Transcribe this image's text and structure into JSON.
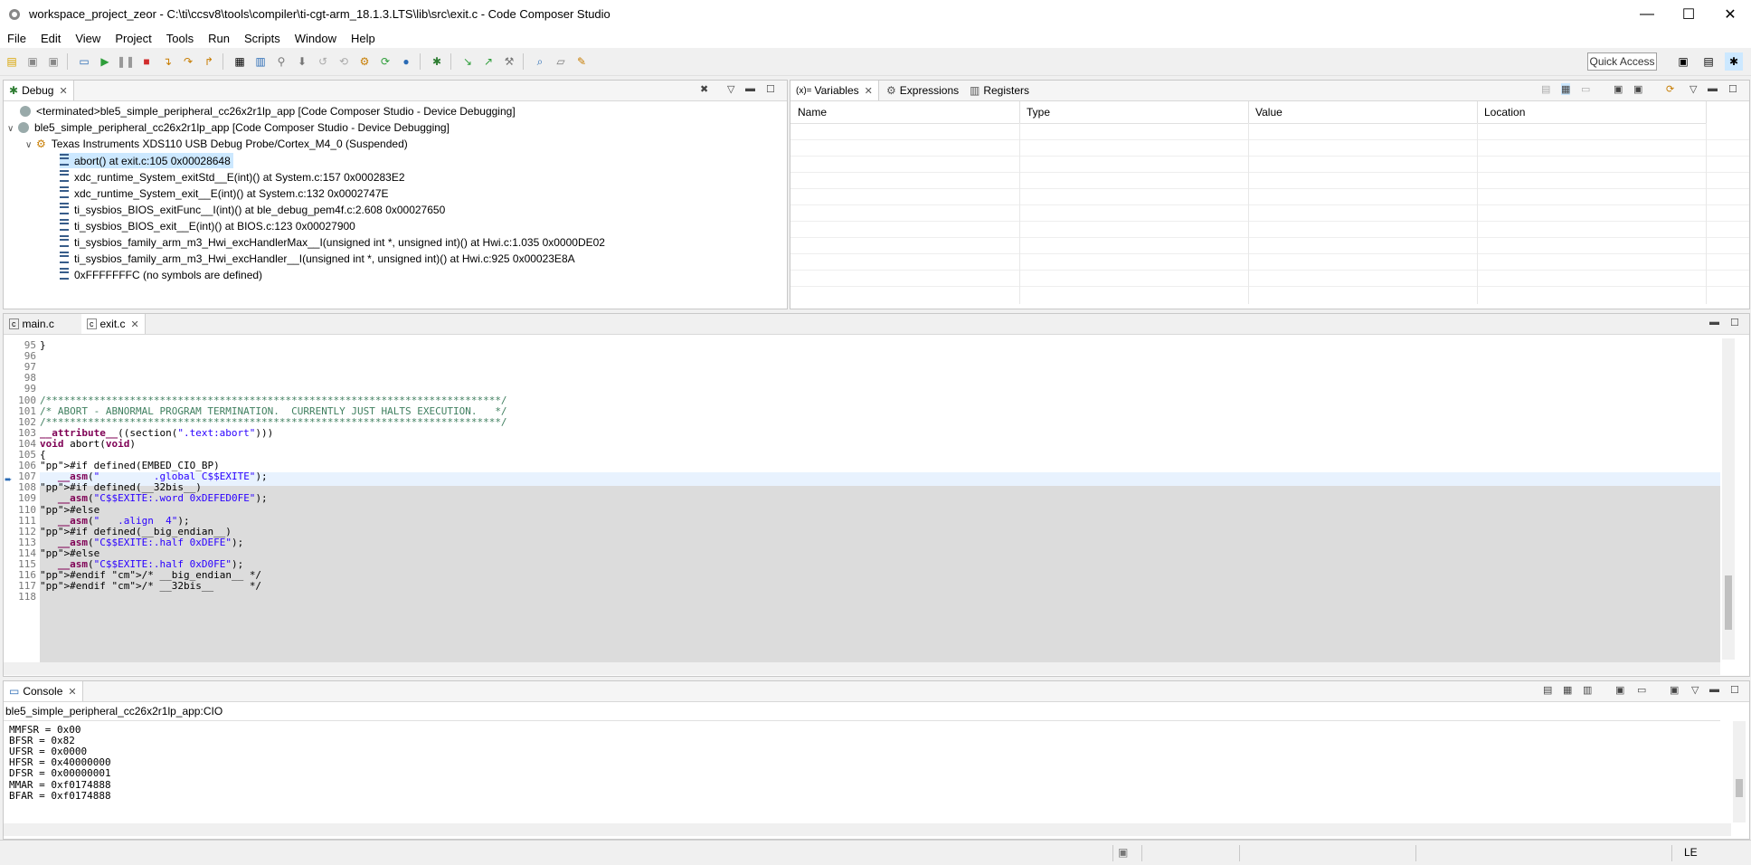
{
  "window": {
    "title": "workspace_project_zeor - C:\\ti\\ccsv8\\tools\\compiler\\ti-cgt-arm_18.1.3.LTS\\lib\\src\\exit.c - Code Composer Studio",
    "minimize": "—",
    "maximize": "☐",
    "close": "✕"
  },
  "menu": [
    "File",
    "Edit",
    "View",
    "Project",
    "Tools",
    "Run",
    "Scripts",
    "Window",
    "Help"
  ],
  "quick_access": "Quick Access",
  "debug": {
    "tab": "Debug",
    "items": [
      "<terminated>ble5_simple_peripheral_cc26x2r1lp_app [Code Composer Studio - Device Debugging]",
      "ble5_simple_peripheral_cc26x2r1lp_app [Code Composer Studio - Device Debugging]",
      "Texas Instruments XDS110 USB Debug Probe/Cortex_M4_0 (Suspended)"
    ],
    "frames": [
      "abort() at exit.c:105 0x00028648",
      "xdc_runtime_System_exitStd__E(int)() at System.c:157 0x000283E2",
      "xdc_runtime_System_exit__E(int)() at System.c:132 0x0002747E",
      "ti_sysbios_BIOS_exitFunc__I(int)() at ble_debug_pem4f.c:2.608 0x00027650",
      "ti_sysbios_BIOS_exit__E(int)() at BIOS.c:123 0x00027900",
      "ti_sysbios_family_arm_m3_Hwi_excHandlerMax__I(unsigned int *, unsigned int)() at Hwi.c:1.035 0x0000DE02",
      "ti_sysbios_family_arm_m3_Hwi_excHandler__I(unsigned int *, unsigned int)() at Hwi.c:925 0x00023E8A",
      "0xFFFFFFFC  (no symbols are defined)"
    ]
  },
  "vars": {
    "tabs": [
      "Variables",
      "Expressions",
      "Registers"
    ],
    "tab_prefix": "(x)=",
    "columns": [
      "Name",
      "Type",
      "Value",
      "Location"
    ]
  },
  "editor": {
    "tabs": [
      "main.c",
      "exit.c"
    ],
    "lines": [
      {
        "n": "95",
        "t": "}"
      },
      {
        "n": "96",
        "t": ""
      },
      {
        "n": "97",
        "t": ""
      },
      {
        "n": "98",
        "t": ""
      },
      {
        "n": "99",
        "t": ""
      },
      {
        "n": "100",
        "t": "/****************************************************************************/"
      },
      {
        "n": "101",
        "t": "/* ABORT - ABNORMAL PROGRAM TERMINATION.  CURRENTLY JUST HALTS EXECUTION.   */"
      },
      {
        "n": "102",
        "t": "/****************************************************************************/"
      },
      {
        "n": "103",
        "t": "__attribute__((section(\".text:abort\")))"
      },
      {
        "n": "104",
        "t": "void abort(void)"
      },
      {
        "n": "105",
        "t": "{"
      },
      {
        "n": "106",
        "t": "#if defined(EMBED_CIO_BP)"
      },
      {
        "n": "107",
        "t": "   __asm(\"         .global C$$EXITE\");"
      },
      {
        "n": "108",
        "t": "#if defined(__32bis__)"
      },
      {
        "n": "109",
        "t": "   __asm(\"C$$EXITE:.word 0xDEFED0FE\");"
      },
      {
        "n": "110",
        "t": "#else"
      },
      {
        "n": "111",
        "t": "   __asm(\"   .align  4\");"
      },
      {
        "n": "112",
        "t": "#if defined(__big_endian__)"
      },
      {
        "n": "113",
        "t": "   __asm(\"C$$EXITE:.half 0xDEFE\");"
      },
      {
        "n": "114",
        "t": "#else"
      },
      {
        "n": "115",
        "t": "   __asm(\"C$$EXITE:.half 0xD0FE\");"
      },
      {
        "n": "116",
        "t": "#endif /* __big_endian__ */"
      },
      {
        "n": "117",
        "t": "#endif /* __32bis__      */"
      },
      {
        "n": "118",
        "t": ""
      }
    ]
  },
  "console": {
    "tab": "Console",
    "header": "ble5_simple_peripheral_cc26x2r1lp_app:CIO",
    "lines": [
      "MMFSR = 0x00",
      "BFSR = 0x82",
      "UFSR = 0x0000",
      "HFSR = 0x40000000",
      "DFSR = 0x00000001",
      "MMAR = 0xf0174888",
      "BFAR = 0xf0174888"
    ]
  },
  "status": {
    "endian": "LE"
  }
}
